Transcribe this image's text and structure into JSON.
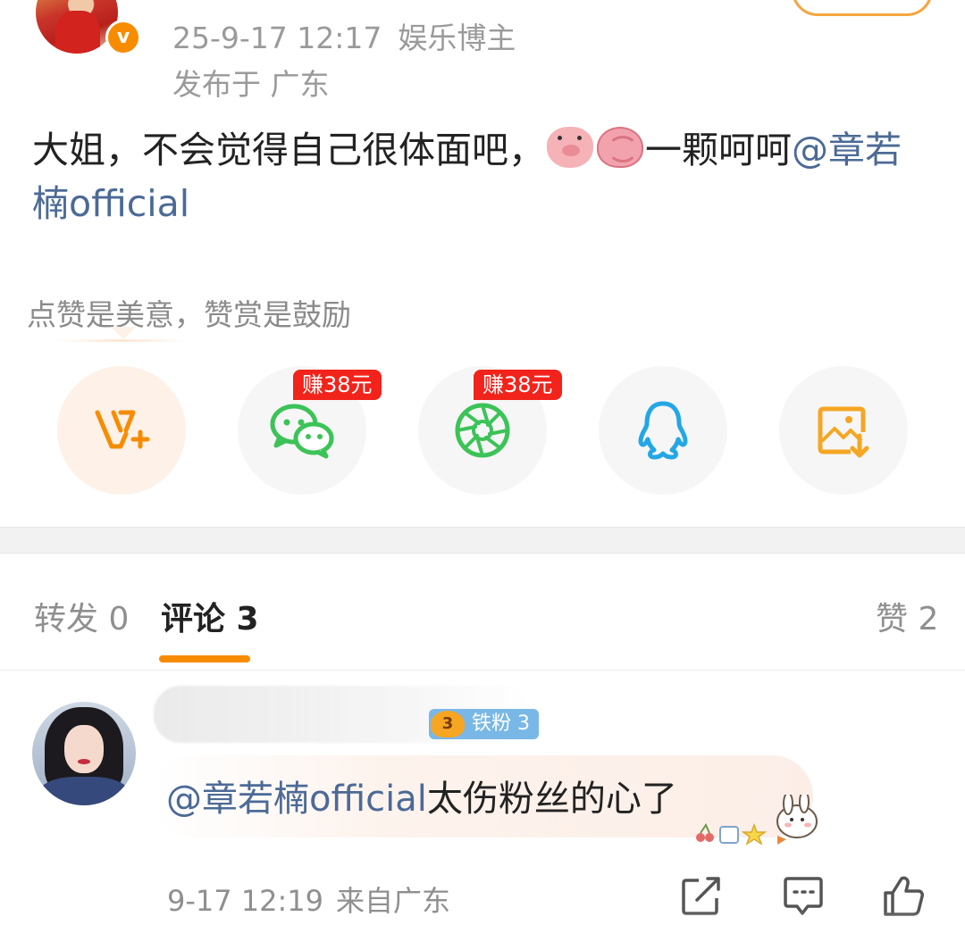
{
  "post": {
    "time": "25-9-17 12:17",
    "author_tag": "娱乐博主",
    "location": "发布于 广东",
    "text_before": "大姐，不会觉得自己很体面吧，",
    "emoji_1": "pig-face-emoji",
    "emoji_2": "brain-emoji",
    "text_after": "一颗呵呵",
    "mention": "@章若楠official",
    "verified_badge": "v"
  },
  "reward": {
    "text": "点赞是美意，赞赏是鼓励"
  },
  "share": {
    "earn_tag_wechat": "赚38元",
    "earn_tag_moments": "赚38元",
    "items": [
      "vplus-icon",
      "wechat-icon",
      "moments-icon",
      "qq-icon",
      "save-image-icon"
    ],
    "colors": {
      "orange": "#f78c00",
      "green": "#3cc358",
      "blue": "#23a7e5",
      "red": "#f1231b"
    }
  },
  "tabs": {
    "repost": "转发 0",
    "comment": "评论 3",
    "like": "赞 2"
  },
  "comment": {
    "fan_badge": "铁粉 3",
    "fan_level": "3",
    "mention": "@章若楠official",
    "text": "太伤粉丝的心了",
    "time": "9-17 12:19",
    "source": "来自广东"
  }
}
